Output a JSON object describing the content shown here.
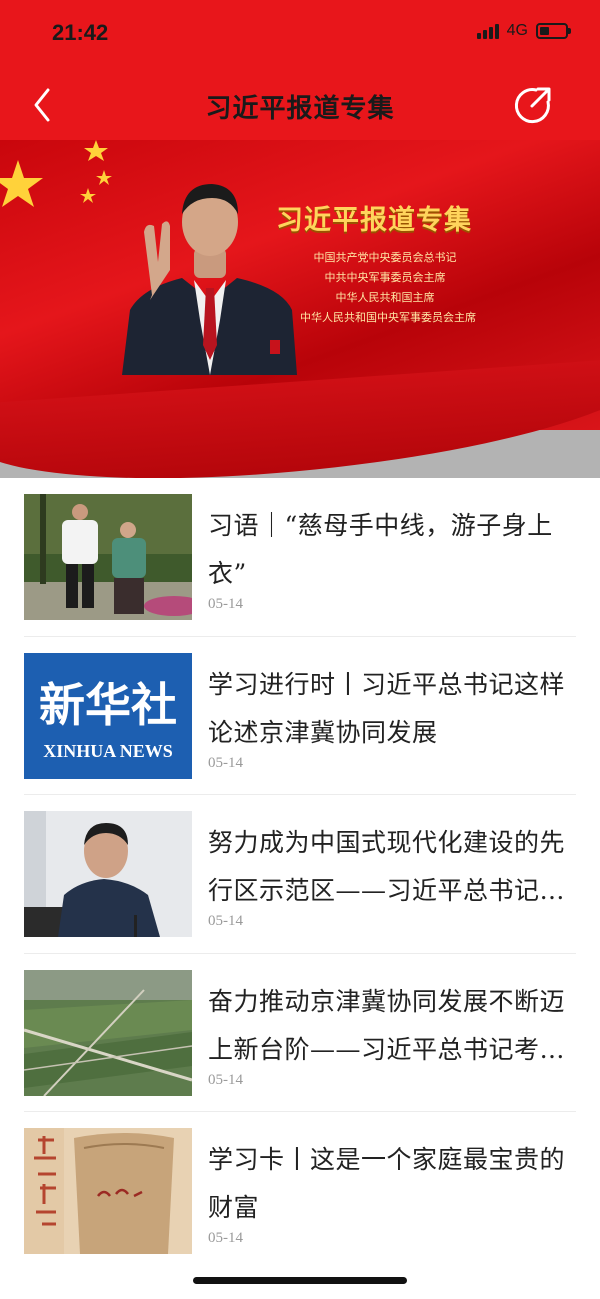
{
  "status_bar": {
    "time": "21:42",
    "network": "4G"
  },
  "nav": {
    "title": "习近平报道专集",
    "back_icon": "chevron-left-icon",
    "share_icon": "share-icon"
  },
  "banner": {
    "title": "习近平报道专集",
    "subtitles": [
      "中国共产党中央委员会总书记",
      "中共中央军事委员会主席",
      "中华人民共和国主席",
      "中华人民共和国中央军事委员会主席"
    ],
    "colors": {
      "background": "#e5161b",
      "title": "#ffd45c"
    }
  },
  "news": [
    {
      "title": "习语｜“慈母手中线，游子身上衣”",
      "date": "05-14",
      "thumb": "garden-photo"
    },
    {
      "title": "学习进行时丨习近平总书记这样论述京津冀协同发展",
      "date": "05-14",
      "thumb": "xinhua-news-logo",
      "logo_cn": "新华社",
      "logo_en": "XINHUA NEWS"
    },
    {
      "title": "努力成为中国式现代化建设的先行区示范区——习近平总书记考察河北雄安新区并主持召开深入推进京津冀协同发展座谈会纪实",
      "date": "05-14",
      "thumb": "speaker-photo"
    },
    {
      "title": "奋力推动京津冀协同发展不断迈上新台阶——习近平总书记考察河北纪实",
      "date": "05-14",
      "thumb": "farmland-aerial-photo"
    },
    {
      "title": "学习卡丨这是一个家庭最宝贵的财富",
      "date": "05-14",
      "thumb": "embroidered-bag-photo"
    }
  ],
  "colors": {
    "accent": "#e8161b",
    "date": "#9a9a9a"
  }
}
